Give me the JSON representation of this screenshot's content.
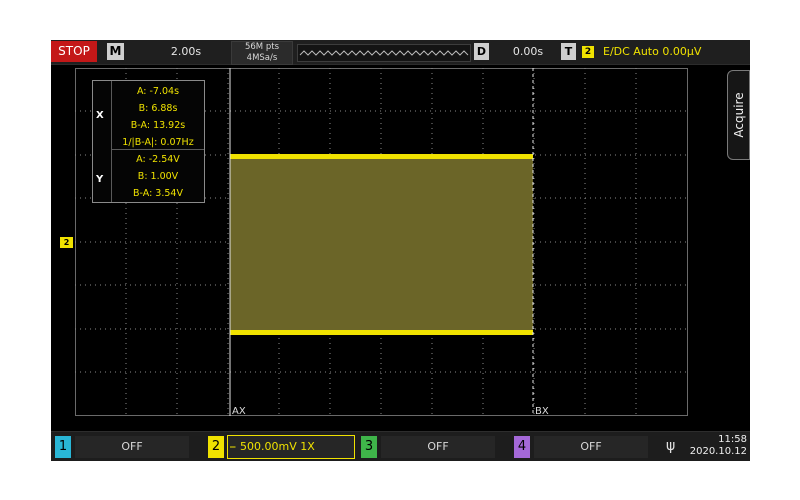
{
  "topbar": {
    "run_state": "STOP",
    "mode_label": "M",
    "timebase": "2.00s",
    "memory_depth": "56M pts",
    "sample_rate": "4MSa/s",
    "delay_label": "D",
    "delay": "0.00s",
    "trigger_label": "T",
    "trigger_channel": "2",
    "trigger_info": "E∕DC Auto 0.00μV"
  },
  "side_tab": {
    "label": "Acquire"
  },
  "channel_marker": "2",
  "cursors": {
    "a_label": "AX",
    "b_label": "BX"
  },
  "measurements": {
    "x_label": "X",
    "y_label": "Y",
    "x_rows": [
      "A: -7.04s",
      "B: 6.88s",
      "B-A: 13.92s",
      "1/|B-A|: 0.07Hz"
    ],
    "y_rows": [
      "A: -2.54V",
      "B: 1.00V",
      "B-A: 3.54V"
    ]
  },
  "channels": [
    {
      "number": "1",
      "state": "OFF",
      "color": "#29b6d6"
    },
    {
      "number": "2",
      "state": "500.00mV 1X",
      "color": "#f0e200"
    },
    {
      "number": "3",
      "state": "OFF",
      "color": "#3fb54a"
    },
    {
      "number": "4",
      "state": "OFF",
      "color": "#a468d8"
    }
  ],
  "status": {
    "usb_icon": "usb-icon",
    "time": "11:58",
    "date": "2020.10.12"
  },
  "colors": {
    "waveform": "#f0e200",
    "waveform_fill": "#6b6528",
    "stop": "#c41818",
    "grid": "#8a8a8a"
  }
}
